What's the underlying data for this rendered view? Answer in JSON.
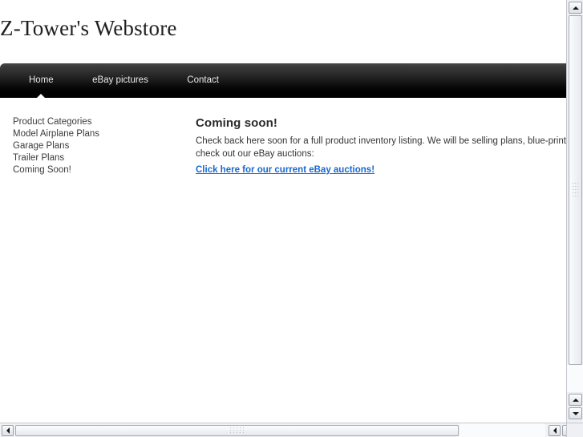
{
  "site": {
    "title": "Z-Tower's Webstore"
  },
  "nav": {
    "items": [
      {
        "label": "Home",
        "active": true
      },
      {
        "label": "eBay pictures",
        "active": false
      },
      {
        "label": "Contact",
        "active": false
      }
    ]
  },
  "sidebar": {
    "items": [
      {
        "label": "Product Categories"
      },
      {
        "label": "Model Airplane Plans"
      },
      {
        "label": "Garage Plans"
      },
      {
        "label": "Trailer Plans"
      },
      {
        "label": "Coming Soon!"
      }
    ]
  },
  "content": {
    "heading": "Coming soon!",
    "body_line1": "Check back here soon for a full product inventory listing.  We will be selling plans, blue-prints, and how-to instructions.  In the meantime,",
    "body_line2": "check out our eBay auctions:",
    "link_text": "Click here for our current eBay auctions!"
  },
  "scrollbars": {
    "vertical": {
      "up_arrow": "scroll-up",
      "down_arrow": "scroll-down",
      "extra_up_arrow": "scroll-up"
    },
    "horizontal": {
      "left_arrow": "scroll-left",
      "right_arrow": "scroll-right"
    }
  },
  "colors": {
    "nav_top": "#4b4b4b",
    "nav_bottom": "#000000",
    "link": "#1767cf",
    "text": "#343434",
    "background": "#ffffff"
  }
}
